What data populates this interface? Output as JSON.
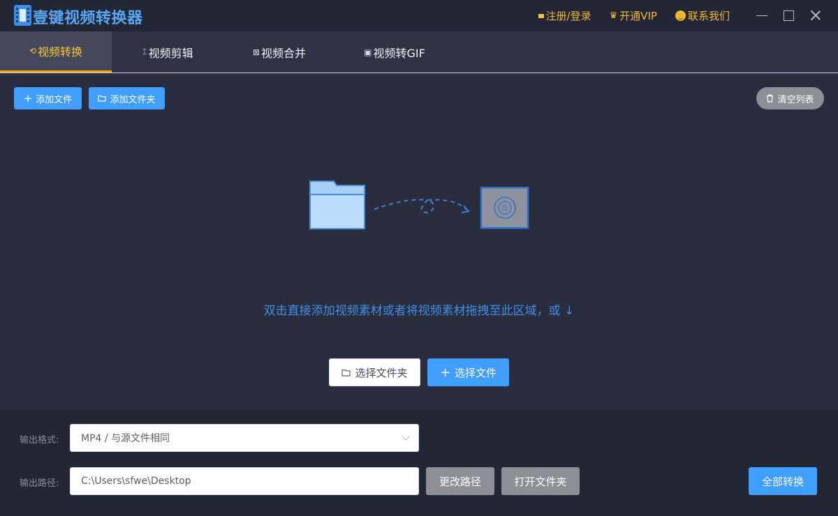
{
  "app": {
    "title": "壹键视频转换器"
  },
  "top_links": [
    {
      "label": "注册/登录",
      "icon": "key-icon"
    },
    {
      "label": "开通VIP",
      "icon": "crown-icon"
    },
    {
      "label": "联系我们",
      "icon": "smile-icon"
    }
  ],
  "tabs": [
    {
      "label": "视频转换",
      "icon": "convert-icon",
      "active": true
    },
    {
      "label": "视频剪辑",
      "icon": "cut-icon",
      "active": false
    },
    {
      "label": "视频合并",
      "icon": "merge-icon",
      "active": false
    },
    {
      "label": "视频转GIF",
      "icon": "gif-icon",
      "active": false
    }
  ],
  "toolbar": {
    "add_file": "添加文件",
    "add_folder": "添加文件夹",
    "clear_list": "清空列表"
  },
  "dropzone": {
    "prompt": "双击直接添加视频素材或者将视频素材拖拽至此区域，或 ↓",
    "choose_folder": "选择文件夹",
    "choose_file": "选择文件"
  },
  "output": {
    "format_label": "输出格式:",
    "format_value": "MP4 / 与源文件相同",
    "path_label": "输出路径:",
    "path_value": "C:\\Users\\sfwe\\Desktop",
    "change_path": "更改路径",
    "open_folder": "打开文件夹",
    "convert_all": "全部转换"
  },
  "colors": {
    "accent_blue": "#409eff",
    "tab_active_text": "#f5c842",
    "tab_active_underline": "#f0a818",
    "link_gold": "#f1b73a",
    "title_blue": "#59a6f5"
  }
}
